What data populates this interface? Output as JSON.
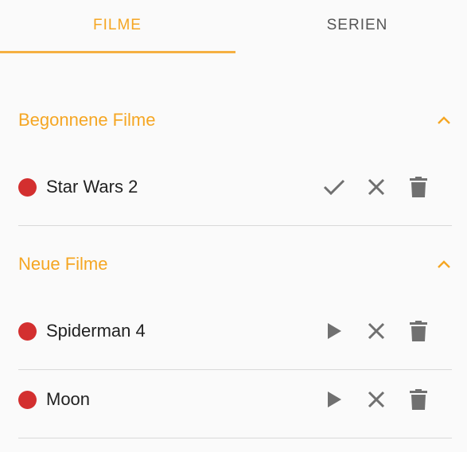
{
  "tabs": {
    "filme": "FILME",
    "serien": "SERIEN",
    "active": "filme"
  },
  "colors": {
    "accent": "#f5a623",
    "status_dot": "#d32f2f",
    "icon": "#707070"
  },
  "sections": [
    {
      "title": "Begonnene Filme",
      "toggle_icon": "chevron-up-icon",
      "items": [
        {
          "title": "Star Wars 2",
          "actions": [
            "check-icon",
            "close-icon",
            "delete-icon"
          ]
        }
      ]
    },
    {
      "title": "Neue Filme",
      "toggle_icon": "chevron-up-icon",
      "items": [
        {
          "title": "Spiderman 4",
          "actions": [
            "play-icon",
            "close-icon",
            "delete-icon"
          ]
        },
        {
          "title": "Moon",
          "actions": [
            "play-icon",
            "close-icon",
            "delete-icon"
          ]
        }
      ]
    }
  ]
}
